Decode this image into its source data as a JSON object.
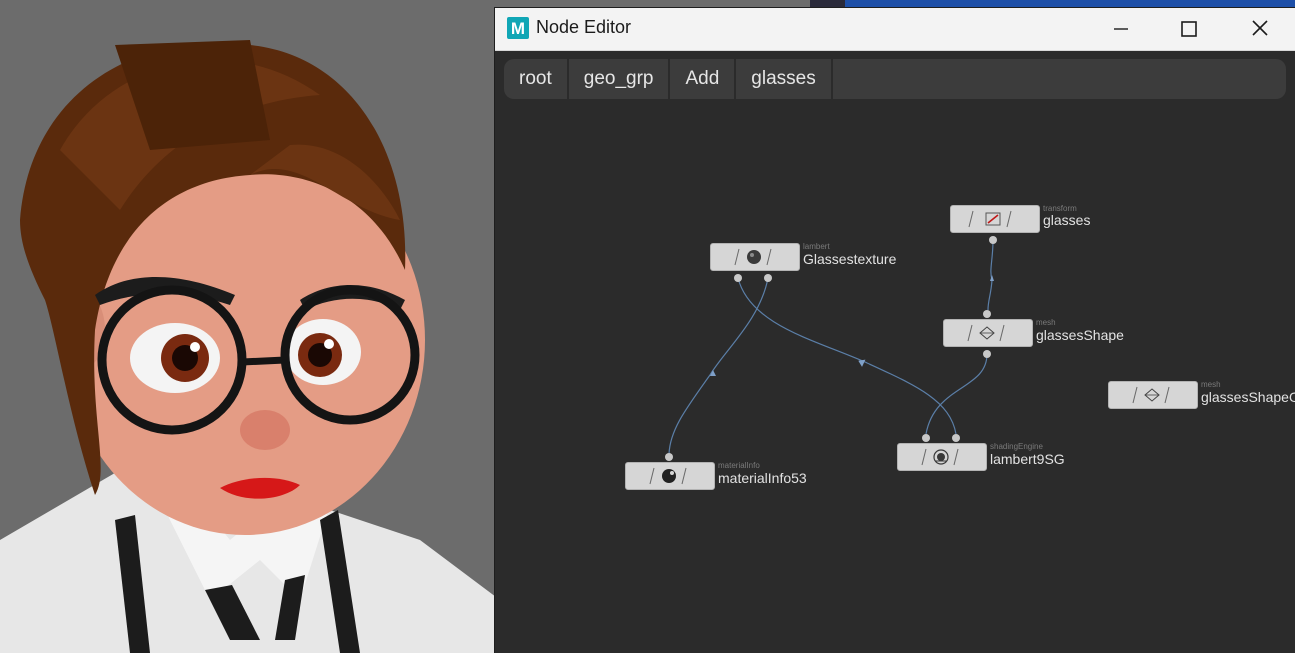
{
  "window": {
    "title": "Node Editor",
    "logo_letter": "M",
    "logo_color": "#10a6b5",
    "icons": [
      "minimize-icon",
      "maximize-icon",
      "close-icon"
    ]
  },
  "breadcrumb": [
    "root",
    "geo_grp",
    "Add",
    "glasses"
  ],
  "nodes": {
    "glasses": {
      "type": "transform",
      "name": "glasses",
      "icon": "transform-icon"
    },
    "glassestexture": {
      "type": "lambert",
      "name": "Glassestexture",
      "icon": "sphere-icon"
    },
    "glassesshape": {
      "type": "mesh",
      "name": "glassesShape",
      "icon": "mesh-icon"
    },
    "glassesshapeorig": {
      "type": "mesh",
      "name": "glassesShapeO",
      "icon": "mesh-icon"
    },
    "lambert9sg": {
      "type": "shadingEngine",
      "name": "lambert9SG",
      "icon": "shading-engine-icon"
    },
    "materialinfo53": {
      "type": "materialInfo",
      "name": "materialInfo53",
      "icon": "material-info-icon"
    }
  },
  "colors": {
    "graph_bg": "#2b2b2b",
    "node_fill": "#d6d6d6",
    "connection": "#5b7fa8"
  }
}
